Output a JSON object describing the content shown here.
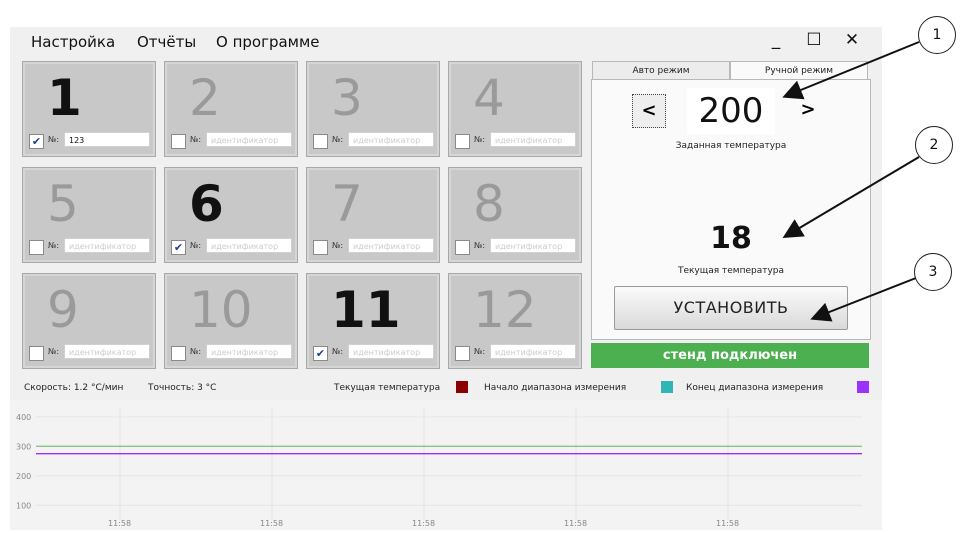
{
  "menu": [
    "Настройка",
    "Отчёты",
    "О программе"
  ],
  "window_controls": {
    "minimize": "_",
    "maximize": "☐",
    "close": "✕"
  },
  "tiles": [
    {
      "num": "1",
      "checked": true,
      "no_label": "№:",
      "id_value": "123",
      "id_placeholder": "идентификатор"
    },
    {
      "num": "2",
      "checked": false,
      "no_label": "№:",
      "id_value": "",
      "id_placeholder": "идентификатор"
    },
    {
      "num": "3",
      "checked": false,
      "no_label": "№:",
      "id_value": "",
      "id_placeholder": "идентификатор"
    },
    {
      "num": "4",
      "checked": false,
      "no_label": "№:",
      "id_value": "",
      "id_placeholder": "идентификатор"
    },
    {
      "num": "5",
      "checked": false,
      "no_label": "№:",
      "id_value": "",
      "id_placeholder": "идентификатор"
    },
    {
      "num": "6",
      "checked": true,
      "no_label": "№:",
      "id_value": "",
      "id_placeholder": "идентификатор"
    },
    {
      "num": "7",
      "checked": false,
      "no_label": "№:",
      "id_value": "",
      "id_placeholder": "идентификатор"
    },
    {
      "num": "8",
      "checked": false,
      "no_label": "№:",
      "id_value": "",
      "id_placeholder": "идентификатор"
    },
    {
      "num": "9",
      "checked": false,
      "no_label": "№:",
      "id_value": "",
      "id_placeholder": "идентификатор"
    },
    {
      "num": "10",
      "checked": false,
      "no_label": "№:",
      "id_value": "",
      "id_placeholder": "идентификатор"
    },
    {
      "num": "11",
      "checked": true,
      "no_label": "№:",
      "id_value": "",
      "id_placeholder": "идентификатор"
    },
    {
      "num": "12",
      "checked": false,
      "no_label": "№:",
      "id_value": "",
      "id_placeholder": "идентификатор"
    }
  ],
  "tabs": {
    "auto": "Авто режим",
    "manual": "Ручной режим"
  },
  "manual": {
    "dec_label": "<",
    "inc_label": ">",
    "set_temp": "200",
    "set_temp_label": "Заданная температура",
    "current_temp": "18",
    "current_temp_label": "Текущая температура",
    "apply_button": "УСТАНОВИТЬ"
  },
  "status": "стенд подключен",
  "info": {
    "speed": "Скорость: 1.2 °С/мин",
    "accuracy": "Точность: 3 °С",
    "legend_current": "Текущая температура",
    "legend_start": "Начало диапазона измерения",
    "legend_end": "Конец диапазона измерения"
  },
  "colors": {
    "current": "#8b0000",
    "start": "#2fb5b5",
    "end": "#9b30ff",
    "status_bg": "#4caf50"
  },
  "callouts": [
    "1",
    "2",
    "3"
  ],
  "chart_data": {
    "type": "line",
    "y_ticks": [
      "400",
      "300",
      "200",
      "100"
    ],
    "x_ticks": [
      "11:58",
      "11:58",
      "11:58",
      "11:58",
      "11:58"
    ],
    "ylim": [
      50,
      430
    ],
    "series": [
      {
        "name": "Начало диапазона измерения",
        "color": "#8bc48b",
        "values": [
          300,
          300
        ]
      },
      {
        "name": "Конец диапазона измерения",
        "color": "#9b30ff",
        "values": [
          275,
          275
        ]
      }
    ]
  }
}
